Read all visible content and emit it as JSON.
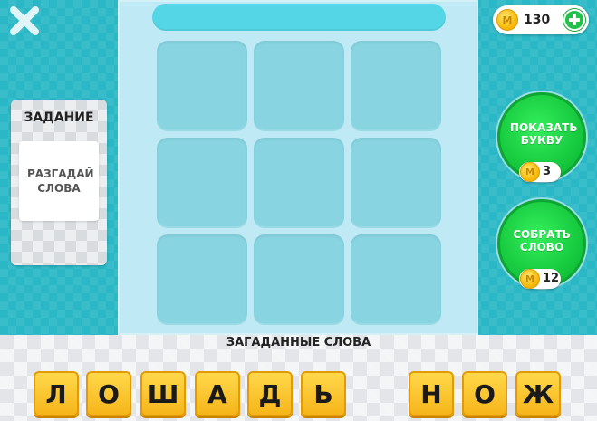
{
  "task": {
    "title": "ЗАДАНИЕ",
    "text": "РАЗГАДАЙ СЛОВА"
  },
  "coins": {
    "symbol": "M",
    "count": "130"
  },
  "powerups": [
    {
      "label": "ПОКАЗАТЬ БУКВУ",
      "price": "3"
    },
    {
      "label": "СОБРАТЬ СЛОВО",
      "price": "12"
    }
  ],
  "hidden_words": {
    "title": "ЗАГАДАННЫЕ СЛОВА",
    "words": [
      {
        "letters": [
          "Л",
          "О",
          "Ш",
          "А",
          "Д",
          "Ь"
        ]
      },
      {
        "letters": [
          "Н",
          "О",
          "Ж"
        ]
      }
    ]
  },
  "grid": {
    "rows": 3,
    "cols": 3
  },
  "colors": {
    "background": "#2bb8c6",
    "board": "#bfeaf5",
    "cell": "#88d4e1",
    "powerup_green": "#12c43a",
    "tile_yellow": "#f6b51a"
  },
  "icons": {
    "close": "close-icon",
    "coin": "coin-icon",
    "add": "plus-icon"
  }
}
